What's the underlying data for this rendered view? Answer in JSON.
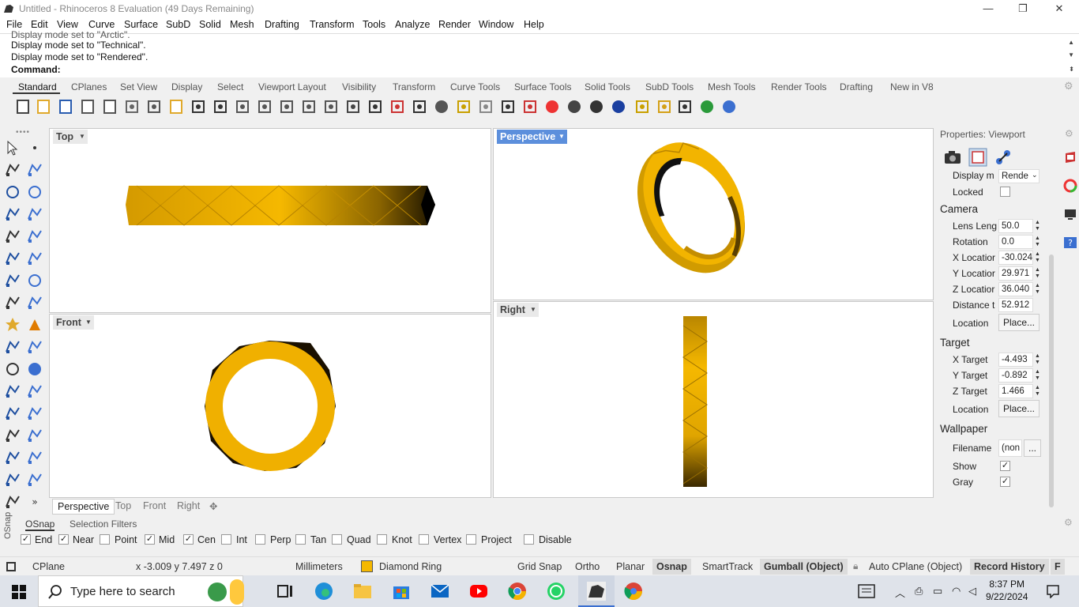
{
  "window": {
    "title": "Untitled - Rhinoceros 8 Evaluation (49 Days Remaining)",
    "min_glyph": "—",
    "max_glyph": "❐",
    "close_glyph": "✕"
  },
  "menu": [
    "File",
    "Edit",
    "View",
    "Curve",
    "Surface",
    "SubD",
    "Solid",
    "Mesh",
    "Drafting",
    "Transform",
    "Tools",
    "Analyze",
    "Render",
    "Window",
    "Help"
  ],
  "command_history": {
    "lines": [
      "Display mode set to \"Arctic\".",
      "Display mode set to \"Technical\".",
      "Display mode set to \"Rendered\"."
    ],
    "prompt": "Command:"
  },
  "toolbar_tabs": [
    "Standard",
    "CPlanes",
    "Set View",
    "Display",
    "Select",
    "Viewport Layout",
    "Visibility",
    "Transform",
    "Curve Tools",
    "Surface Tools",
    "Solid Tools",
    "SubD Tools",
    "Mesh Tools",
    "Render Tools",
    "Drafting",
    "New in V8"
  ],
  "toolbar_icons": [
    "new-icon",
    "open-icon",
    "save-icon",
    "print-icon",
    "import-icon",
    "cut-icon",
    "copy-icon",
    "paste-icon",
    "undo-icon",
    "pan-icon",
    "rotate-view-icon",
    "zoom-icon",
    "zoom-window-icon",
    "zoom-extents-icon",
    "zoom-selected-icon",
    "rotate-icon",
    "four-viewports-icon",
    "car-icon",
    "grid-icon",
    "circle-target-icon",
    "points-icon",
    "light-bulb-icon",
    "lock-icon",
    "material-icon",
    "color-wheel-icon",
    "shade-sphere-icon",
    "wireframe-sphere-icon",
    "render-sphere-icon",
    "pointer-icon",
    "gear-icon",
    "dimension-icon",
    "globe-icon",
    "help-icon"
  ],
  "viewports": {
    "top": {
      "label": "Top"
    },
    "perspective": {
      "label": "Perspective"
    },
    "front": {
      "label": "Front"
    },
    "right": {
      "label": "Right"
    }
  },
  "viewport_tabs": [
    "Perspective",
    "Top",
    "Front",
    "Right"
  ],
  "viewport_tabs_add": "✥",
  "properties": {
    "title": "Properties: Viewport",
    "display_mode_label": "Display m",
    "display_mode_value": "Rende",
    "locked_label": "Locked",
    "camera_header": "Camera",
    "camera": [
      {
        "label": "Lens Leng",
        "value": "50.0"
      },
      {
        "label": "Rotation",
        "value": "0.0"
      },
      {
        "label": "X Locatior",
        "value": "-30.024"
      },
      {
        "label": "Y Locatior",
        "value": "29.971"
      },
      {
        "label": "Z Locatior",
        "value": "36.040"
      },
      {
        "label": "Distance t",
        "value": "52.912"
      }
    ],
    "camera_location_label": "Location",
    "place_button": "Place...",
    "target_header": "Target",
    "target": [
      {
        "label": "X Target",
        "value": "-4.493"
      },
      {
        "label": "Y Target",
        "value": "-0.892"
      },
      {
        "label": "Z Target",
        "value": "1.466"
      }
    ],
    "target_location_label": "Location",
    "wallpaper_header": "Wallpaper",
    "filename_label": "Filename",
    "filename_value": "(non",
    "browse_button": "...",
    "show_label": "Show",
    "gray_label": "Gray"
  },
  "osnap": {
    "side_label": "OSnap",
    "tabs": [
      "OSnap",
      "Selection Filters"
    ],
    "items": [
      {
        "label": "End",
        "checked": true
      },
      {
        "label": "Near",
        "checked": true
      },
      {
        "label": "Point",
        "checked": false
      },
      {
        "label": "Mid",
        "checked": true
      },
      {
        "label": "Cen",
        "checked": true
      },
      {
        "label": "Int",
        "checked": false
      },
      {
        "label": "Perp",
        "checked": false
      },
      {
        "label": "Tan",
        "checked": false
      },
      {
        "label": "Quad",
        "checked": false
      },
      {
        "label": "Knot",
        "checked": false
      },
      {
        "label": "Vertex",
        "checked": false
      },
      {
        "label": "Project",
        "checked": false
      },
      {
        "label": "Disable",
        "checked": false
      }
    ]
  },
  "status": {
    "cplane": "CPlane",
    "coords": "x -3.009  y 7.497  z 0",
    "units": "Millimeters",
    "layer": "Diamond Ring",
    "layer_color": "#f5b800",
    "grid_snap": "Grid Snap",
    "ortho": "Ortho",
    "planar": "Planar",
    "osnap": "Osnap",
    "smarttrack": "SmartTrack",
    "gumball": "Gumball (Object)",
    "auto_cplane": "Auto CPlane (Object)",
    "record_history": "Record History",
    "filter": "F"
  },
  "taskbar": {
    "search_placeholder": "Type here to search",
    "time": "8:37 PM",
    "date": "9/22/2024"
  },
  "colors": {
    "gold": "#e8a800",
    "gold_light": "#ffc107",
    "gold_dark": "#6b4a00",
    "active_viewport": "#5c8fdc"
  }
}
